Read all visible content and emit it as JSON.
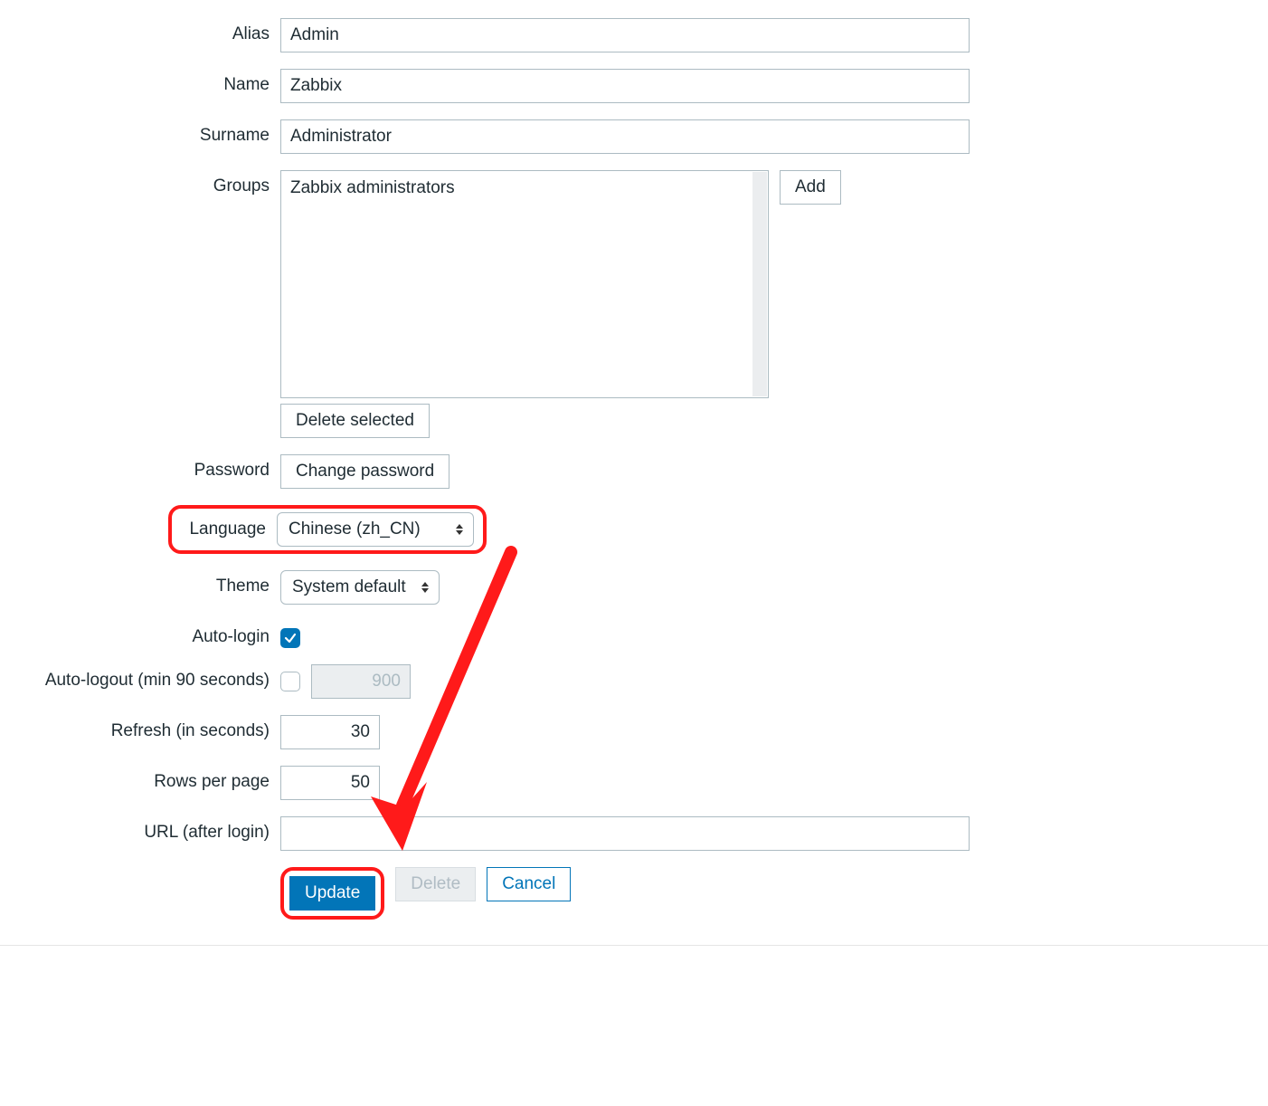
{
  "labels": {
    "alias": "Alias",
    "name": "Name",
    "surname": "Surname",
    "groups": "Groups",
    "password": "Password",
    "language": "Language",
    "theme": "Theme",
    "autologin": "Auto-login",
    "autologout": "Auto-logout (min 90 seconds)",
    "refresh": "Refresh (in seconds)",
    "rowsperpage": "Rows per page",
    "urlafterlogin": "URL (after login)"
  },
  "fields": {
    "alias": "Admin",
    "name": "Zabbix",
    "surname": "Administrator",
    "groups_items": [
      "Zabbix administrators"
    ],
    "language": "Chinese (zh_CN)",
    "theme": "System default",
    "autologin_checked": true,
    "autologout_checked": false,
    "autologout_value": "900",
    "refresh": "30",
    "rowsperpage": "50",
    "url": ""
  },
  "buttons": {
    "add": "Add",
    "delete_selected": "Delete selected",
    "change_password": "Change password",
    "update": "Update",
    "delete": "Delete",
    "cancel": "Cancel"
  }
}
